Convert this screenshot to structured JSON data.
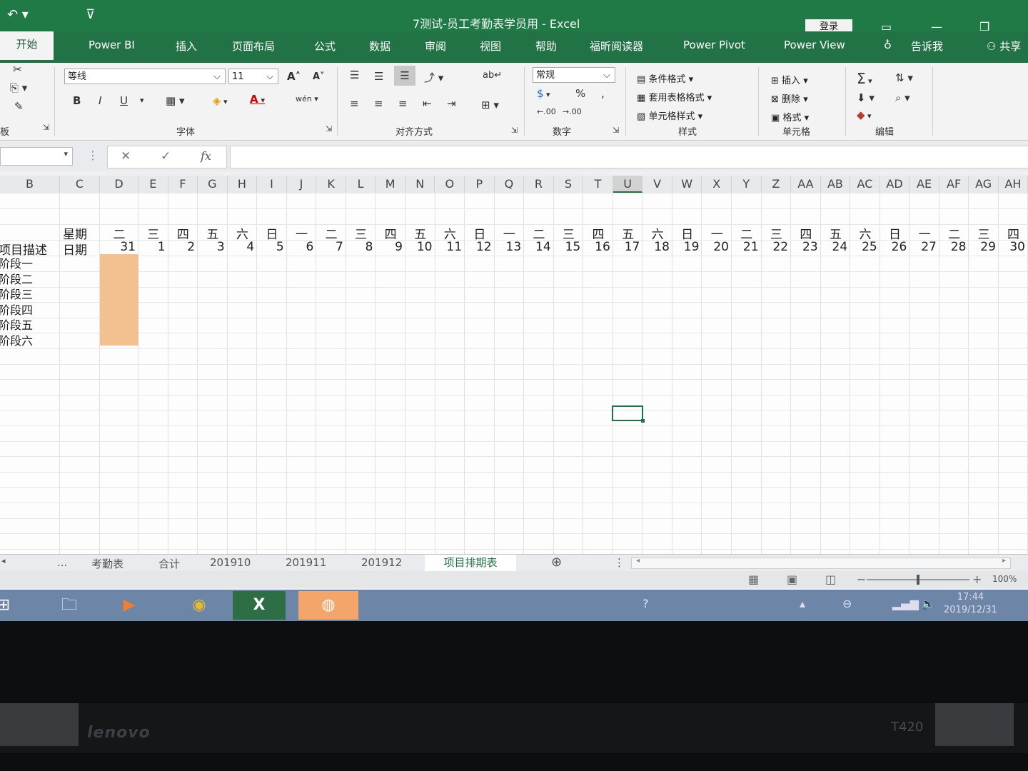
{
  "window": {
    "title": "7测试-员工考勤表学员用 - Excel",
    "login_label": "登录",
    "undo_icon": "undo-icon",
    "quick_access_icon": "customize-icon"
  },
  "ribbon_tabs": [
    "开始",
    "Power BI",
    "插入",
    "页面布局",
    "公式",
    "数据",
    "审阅",
    "视图",
    "帮助",
    "福昕阅读器",
    "Power Pivot",
    "Power View",
    "告诉我",
    "共享"
  ],
  "ribbon": {
    "font_name": "等线",
    "font_size": "11",
    "number_format": "常规",
    "groups": {
      "clipboard": "板",
      "font": "字体",
      "alignment": "对齐方式",
      "number": "数字",
      "styles": "样式",
      "cells": "单元格",
      "editing": "编辑"
    },
    "styles_items": [
      "条件格式",
      "套用表格格式",
      "单元格样式"
    ],
    "cells_items": [
      "插入",
      "删除",
      "格式"
    ],
    "font_buttons": {
      "bold": "B",
      "italic": "I",
      "underline": "U",
      "increase": "A",
      "decrease": "A",
      "phonetic": "wén"
    },
    "percent": "%",
    "comma": ",",
    "inc_decimal": ".00",
    "dec_decimal": ".00"
  },
  "formula_bar": {
    "cancel": "✕",
    "enter": "✓",
    "fx": "fx",
    "value": ""
  },
  "columns": [
    "B",
    "C",
    "D",
    "E",
    "F",
    "G",
    "H",
    "I",
    "J",
    "K",
    "L",
    "M",
    "N",
    "O",
    "P",
    "Q",
    "R",
    "S",
    "T",
    "U",
    "V",
    "W",
    "X",
    "Y",
    "Z",
    "AA",
    "AB",
    "AC",
    "AD",
    "AE",
    "AF",
    "AG",
    "AH"
  ],
  "selected_column": "U",
  "sheet": {
    "weekday_label": "星期",
    "date_label": "日期",
    "desc_label": "项目描述",
    "weekdays": [
      "二",
      "三",
      "四",
      "五",
      "六",
      "日",
      "一",
      "二",
      "三",
      "四",
      "五",
      "六",
      "日",
      "一",
      "二",
      "三",
      "四",
      "五",
      "六",
      "日",
      "一",
      "二",
      "三",
      "四",
      "五",
      "六",
      "日",
      "一",
      "二",
      "三",
      "四"
    ],
    "dates": [
      "31",
      "1",
      "2",
      "3",
      "4",
      "5",
      "6",
      "7",
      "8",
      "9",
      "10",
      "11",
      "12",
      "13",
      "14",
      "15",
      "16",
      "17",
      "18",
      "19",
      "20",
      "21",
      "22",
      "23",
      "24",
      "25",
      "26",
      "27",
      "28",
      "29",
      "30"
    ],
    "stages": [
      "阶段一",
      "阶段二",
      "阶段三",
      "阶段四",
      "阶段五",
      "阶段六"
    ]
  },
  "sheet_tabs": [
    "...",
    "考勤表",
    "合计",
    "201910",
    "201911",
    "201912"
  ],
  "active_sheet": "项目排期表",
  "add_sheet": "⊕",
  "zoom": "100%",
  "taskbar": {
    "time": "17:44",
    "date": "2019/12/31",
    "excel": "X"
  },
  "laptop": {
    "brand": "lenovo",
    "model": "T420"
  }
}
